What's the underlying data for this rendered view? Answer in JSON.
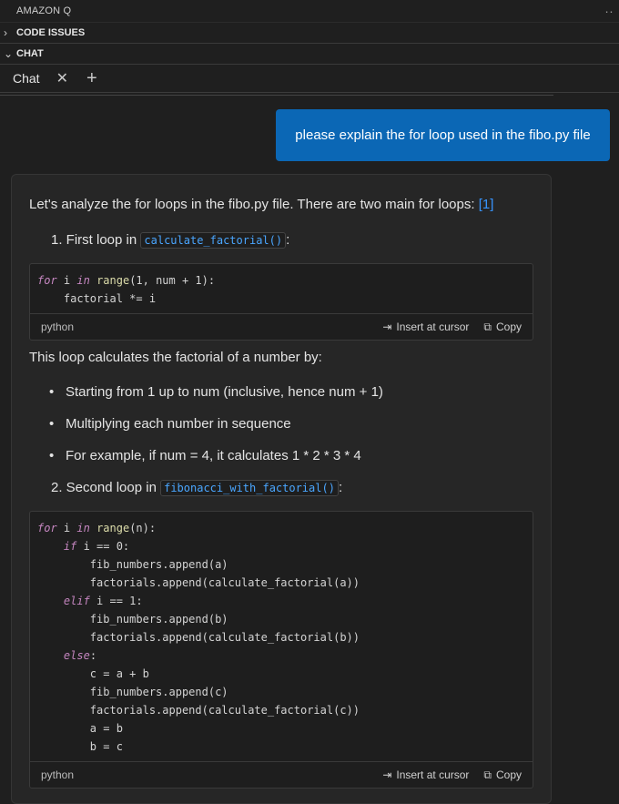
{
  "panel": {
    "title": "AMAZON Q",
    "more_icon": "ellipsis-icon"
  },
  "sections": {
    "code_issues": "CODE ISSUES",
    "chat": "CHAT"
  },
  "tabs": {
    "active_label": "Chat",
    "close_symbol": "✕",
    "new_symbol": "+"
  },
  "user_message": "please explain the for loop used in the fibo.py file",
  "answer": {
    "intro_text": "Let's analyze the for loops in the fibo.py file. There are two main for loops:",
    "intro_ref": "[1]",
    "item1_prefix": "1. First loop in",
    "item1_code": "calculate_factorial()",
    "item1_suffix": ":",
    "block1": {
      "lang": "python",
      "lines": [
        "for i in range(1, num + 1):",
        "    factorial *= i"
      ]
    },
    "desc1": "This loop calculates the factorial of a number by:",
    "bullets": [
      "Starting from 1 up to num (inclusive, hence num + 1)",
      "Multiplying each number in sequence",
      "For example, if num = 4, it calculates 1 * 2 * 3 * 4"
    ],
    "item2_prefix": "2. Second loop in",
    "item2_code": "fibonacci_with_factorial()",
    "item2_suffix": ":",
    "block2": {
      "lang": "python",
      "lines": [
        "for i in range(n):",
        "    if i == 0:",
        "        fib_numbers.append(a)",
        "        factorials.append(calculate_factorial(a))",
        "    elif i == 1:",
        "        fib_numbers.append(b)",
        "        factorials.append(calculate_factorial(b))",
        "    else:",
        "        c = a + b",
        "        fib_numbers.append(c)",
        "        factorials.append(calculate_factorial(c))",
        "        a = b",
        "        b = c"
      ]
    },
    "actions": {
      "insert": "Insert at cursor",
      "copy": "Copy"
    }
  }
}
